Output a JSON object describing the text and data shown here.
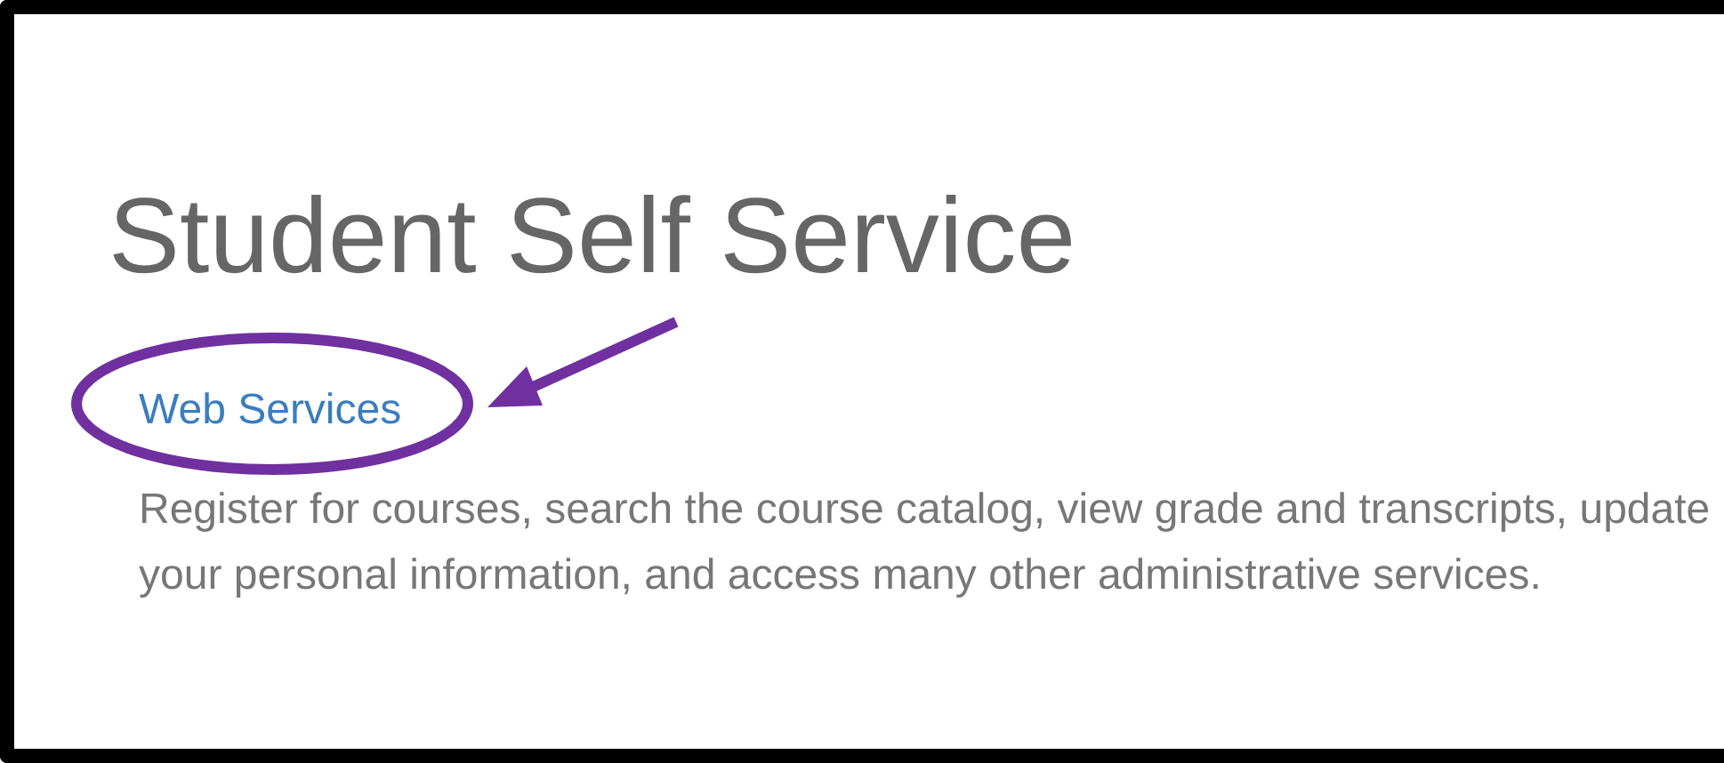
{
  "heading": "Student Self Service",
  "link": {
    "label": "Web Services"
  },
  "description": "Register for courses, search the course catalog, view grade and transcripts, update your personal information, and access many other administrative services."
}
